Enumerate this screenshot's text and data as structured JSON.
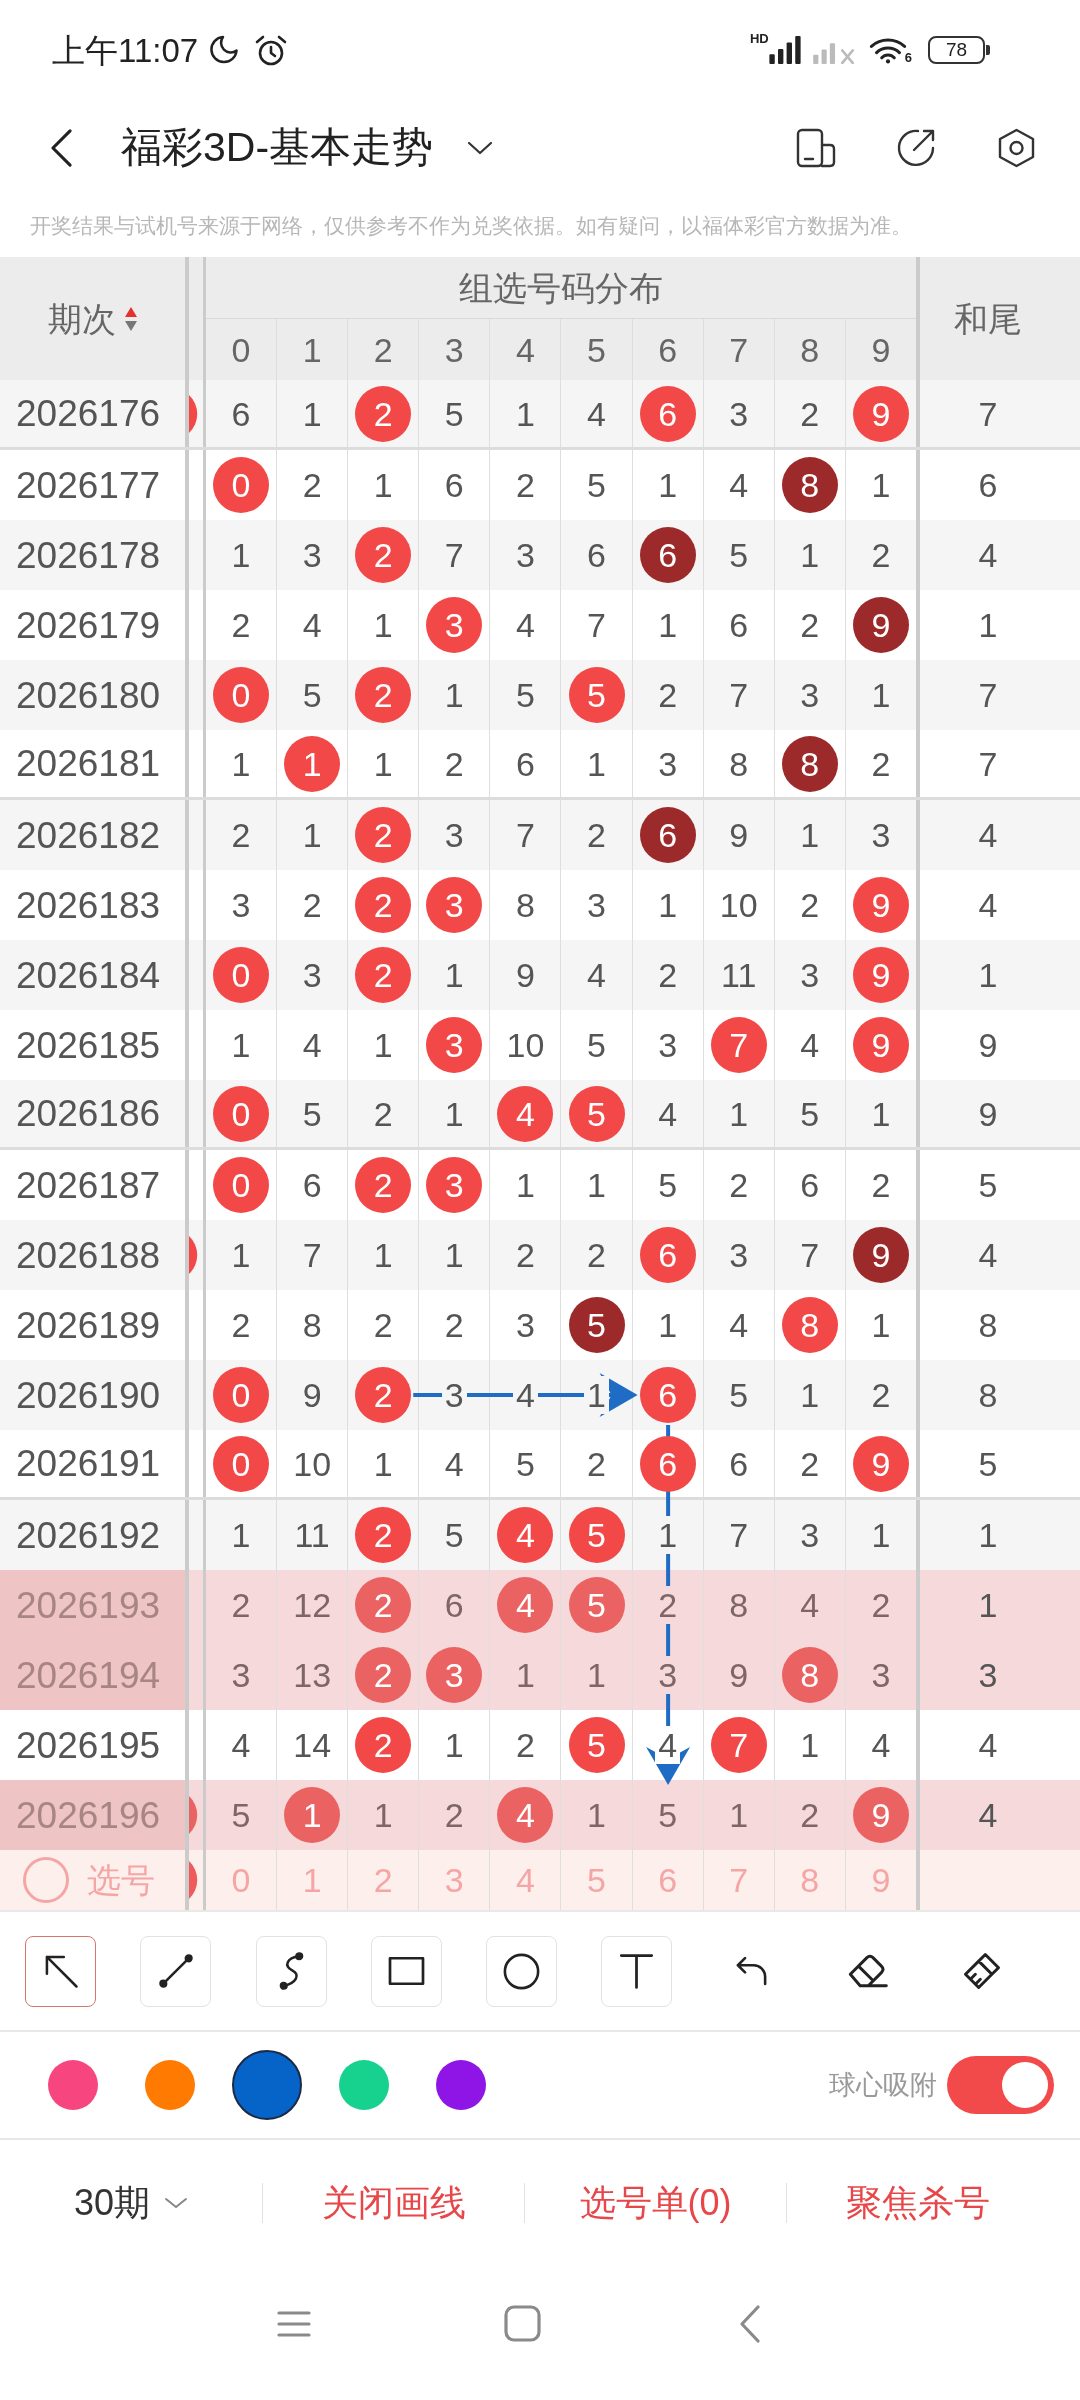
{
  "status_bar": {
    "time": "上午11:07",
    "signal_badge": "HD",
    "wifi_badge": "6",
    "battery": "78"
  },
  "header": {
    "title": "福彩3D-基本走势"
  },
  "notice": "开奖结果与试机号来源于网络，仅供参考不作为兑奖依据。如有疑问，以福体彩官方数据为准。",
  "table": {
    "period_header": "期次",
    "sort_ascending": true,
    "group_header": "组选号码分布",
    "digits": [
      "0",
      "1",
      "2",
      "3",
      "4",
      "5",
      "6",
      "7",
      "8",
      "9"
    ],
    "tail_header": "和尾",
    "rows": [
      {
        "period": "2026176",
        "highlighted": false,
        "edge_ball": true,
        "cells": [
          {
            "text": "6",
            "kind": "miss"
          },
          {
            "text": "1",
            "kind": "miss"
          },
          {
            "text": "2",
            "kind": "hit"
          },
          {
            "text": "5",
            "kind": "miss"
          },
          {
            "text": "1",
            "kind": "miss"
          },
          {
            "text": "4",
            "kind": "miss"
          },
          {
            "text": "6",
            "kind": "hit"
          },
          {
            "text": "3",
            "kind": "miss"
          },
          {
            "text": "2",
            "kind": "miss"
          },
          {
            "text": "9",
            "kind": "hit"
          }
        ],
        "tail": "7"
      },
      {
        "period": "2026177",
        "highlighted": false,
        "edge_ball": false,
        "cells": [
          {
            "text": "0",
            "kind": "hit"
          },
          {
            "text": "2",
            "kind": "miss"
          },
          {
            "text": "1",
            "kind": "miss"
          },
          {
            "text": "6",
            "kind": "miss"
          },
          {
            "text": "2",
            "kind": "miss"
          },
          {
            "text": "5",
            "kind": "miss"
          },
          {
            "text": "1",
            "kind": "miss"
          },
          {
            "text": "4",
            "kind": "miss"
          },
          {
            "text": "8",
            "kind": "repeat"
          },
          {
            "text": "1",
            "kind": "miss"
          }
        ],
        "tail": "6"
      },
      {
        "period": "2026178",
        "highlighted": false,
        "edge_ball": false,
        "cells": [
          {
            "text": "1",
            "kind": "miss"
          },
          {
            "text": "3",
            "kind": "miss"
          },
          {
            "text": "2",
            "kind": "hit"
          },
          {
            "text": "7",
            "kind": "miss"
          },
          {
            "text": "3",
            "kind": "miss"
          },
          {
            "text": "6",
            "kind": "miss"
          },
          {
            "text": "6",
            "kind": "repeat"
          },
          {
            "text": "5",
            "kind": "miss"
          },
          {
            "text": "1",
            "kind": "miss"
          },
          {
            "text": "2",
            "kind": "miss"
          }
        ],
        "tail": "4"
      },
      {
        "period": "2026179",
        "highlighted": false,
        "edge_ball": false,
        "cells": [
          {
            "text": "2",
            "kind": "miss"
          },
          {
            "text": "4",
            "kind": "miss"
          },
          {
            "text": "1",
            "kind": "miss"
          },
          {
            "text": "3",
            "kind": "hit"
          },
          {
            "text": "4",
            "kind": "miss"
          },
          {
            "text": "7",
            "kind": "miss"
          },
          {
            "text": "1",
            "kind": "miss"
          },
          {
            "text": "6",
            "kind": "miss"
          },
          {
            "text": "2",
            "kind": "miss"
          },
          {
            "text": "9",
            "kind": "repeat"
          }
        ],
        "tail": "1"
      },
      {
        "period": "2026180",
        "highlighted": false,
        "edge_ball": false,
        "cells": [
          {
            "text": "0",
            "kind": "hit"
          },
          {
            "text": "5",
            "kind": "miss"
          },
          {
            "text": "2",
            "kind": "hit"
          },
          {
            "text": "1",
            "kind": "miss"
          },
          {
            "text": "5",
            "kind": "miss"
          },
          {
            "text": "5",
            "kind": "hit"
          },
          {
            "text": "2",
            "kind": "miss"
          },
          {
            "text": "7",
            "kind": "miss"
          },
          {
            "text": "3",
            "kind": "miss"
          },
          {
            "text": "1",
            "kind": "miss"
          }
        ],
        "tail": "7"
      },
      {
        "period": "2026181",
        "highlighted": false,
        "edge_ball": false,
        "cells": [
          {
            "text": "1",
            "kind": "miss"
          },
          {
            "text": "1",
            "kind": "hit"
          },
          {
            "text": "1",
            "kind": "miss"
          },
          {
            "text": "2",
            "kind": "miss"
          },
          {
            "text": "6",
            "kind": "miss"
          },
          {
            "text": "1",
            "kind": "miss"
          },
          {
            "text": "3",
            "kind": "miss"
          },
          {
            "text": "8",
            "kind": "miss"
          },
          {
            "text": "8",
            "kind": "repeat"
          },
          {
            "text": "2",
            "kind": "miss"
          }
        ],
        "tail": "7"
      },
      {
        "period": "2026182",
        "highlighted": false,
        "edge_ball": false,
        "cells": [
          {
            "text": "2",
            "kind": "miss"
          },
          {
            "text": "1",
            "kind": "miss"
          },
          {
            "text": "2",
            "kind": "hit"
          },
          {
            "text": "3",
            "kind": "miss"
          },
          {
            "text": "7",
            "kind": "miss"
          },
          {
            "text": "2",
            "kind": "miss"
          },
          {
            "text": "6",
            "kind": "repeat"
          },
          {
            "text": "9",
            "kind": "miss"
          },
          {
            "text": "1",
            "kind": "miss"
          },
          {
            "text": "3",
            "kind": "miss"
          }
        ],
        "tail": "4"
      },
      {
        "period": "2026183",
        "highlighted": false,
        "edge_ball": false,
        "cells": [
          {
            "text": "3",
            "kind": "miss"
          },
          {
            "text": "2",
            "kind": "miss"
          },
          {
            "text": "2",
            "kind": "hit"
          },
          {
            "text": "3",
            "kind": "hit"
          },
          {
            "text": "8",
            "kind": "miss"
          },
          {
            "text": "3",
            "kind": "miss"
          },
          {
            "text": "1",
            "kind": "miss"
          },
          {
            "text": "10",
            "kind": "miss"
          },
          {
            "text": "2",
            "kind": "miss"
          },
          {
            "text": "9",
            "kind": "hit"
          }
        ],
        "tail": "4"
      },
      {
        "period": "2026184",
        "highlighted": false,
        "edge_ball": false,
        "cells": [
          {
            "text": "0",
            "kind": "hit"
          },
          {
            "text": "3",
            "kind": "miss"
          },
          {
            "text": "2",
            "kind": "hit"
          },
          {
            "text": "1",
            "kind": "miss"
          },
          {
            "text": "9",
            "kind": "miss"
          },
          {
            "text": "4",
            "kind": "miss"
          },
          {
            "text": "2",
            "kind": "miss"
          },
          {
            "text": "11",
            "kind": "miss"
          },
          {
            "text": "3",
            "kind": "miss"
          },
          {
            "text": "9",
            "kind": "hit"
          }
        ],
        "tail": "1"
      },
      {
        "period": "2026185",
        "highlighted": false,
        "edge_ball": false,
        "cells": [
          {
            "text": "1",
            "kind": "miss"
          },
          {
            "text": "4",
            "kind": "miss"
          },
          {
            "text": "1",
            "kind": "miss"
          },
          {
            "text": "3",
            "kind": "hit"
          },
          {
            "text": "10",
            "kind": "miss"
          },
          {
            "text": "5",
            "kind": "miss"
          },
          {
            "text": "3",
            "kind": "miss"
          },
          {
            "text": "7",
            "kind": "hit"
          },
          {
            "text": "4",
            "kind": "miss"
          },
          {
            "text": "9",
            "kind": "hit"
          }
        ],
        "tail": "9"
      },
      {
        "period": "2026186",
        "highlighted": false,
        "edge_ball": false,
        "cells": [
          {
            "text": "0",
            "kind": "hit"
          },
          {
            "text": "5",
            "kind": "miss"
          },
          {
            "text": "2",
            "kind": "miss"
          },
          {
            "text": "1",
            "kind": "miss"
          },
          {
            "text": "4",
            "kind": "hit"
          },
          {
            "text": "5",
            "kind": "hit"
          },
          {
            "text": "4",
            "kind": "miss"
          },
          {
            "text": "1",
            "kind": "miss"
          },
          {
            "text": "5",
            "kind": "miss"
          },
          {
            "text": "1",
            "kind": "miss"
          }
        ],
        "tail": "9"
      },
      {
        "period": "2026187",
        "highlighted": false,
        "edge_ball": false,
        "cells": [
          {
            "text": "0",
            "kind": "hit"
          },
          {
            "text": "6",
            "kind": "miss"
          },
          {
            "text": "2",
            "kind": "hit"
          },
          {
            "text": "3",
            "kind": "hit"
          },
          {
            "text": "1",
            "kind": "miss"
          },
          {
            "text": "1",
            "kind": "miss"
          },
          {
            "text": "5",
            "kind": "miss"
          },
          {
            "text": "2",
            "kind": "miss"
          },
          {
            "text": "6",
            "kind": "miss"
          },
          {
            "text": "2",
            "kind": "miss"
          }
        ],
        "tail": "5"
      },
      {
        "period": "2026188",
        "highlighted": false,
        "edge_ball": true,
        "cells": [
          {
            "text": "1",
            "kind": "miss"
          },
          {
            "text": "7",
            "kind": "miss"
          },
          {
            "text": "1",
            "kind": "miss"
          },
          {
            "text": "1",
            "kind": "miss"
          },
          {
            "text": "2",
            "kind": "miss"
          },
          {
            "text": "2",
            "kind": "miss"
          },
          {
            "text": "6",
            "kind": "hit"
          },
          {
            "text": "3",
            "kind": "miss"
          },
          {
            "text": "7",
            "kind": "miss"
          },
          {
            "text": "9",
            "kind": "repeat"
          }
        ],
        "tail": "4"
      },
      {
        "period": "2026189",
        "highlighted": false,
        "edge_ball": false,
        "cells": [
          {
            "text": "2",
            "kind": "miss"
          },
          {
            "text": "8",
            "kind": "miss"
          },
          {
            "text": "2",
            "kind": "miss"
          },
          {
            "text": "2",
            "kind": "miss"
          },
          {
            "text": "3",
            "kind": "miss"
          },
          {
            "text": "5",
            "kind": "repeat"
          },
          {
            "text": "1",
            "kind": "miss"
          },
          {
            "text": "4",
            "kind": "miss"
          },
          {
            "text": "8",
            "kind": "hit"
          },
          {
            "text": "1",
            "kind": "miss"
          }
        ],
        "tail": "8"
      },
      {
        "period": "2026190",
        "highlighted": false,
        "edge_ball": false,
        "arrow_right": true,
        "cells": [
          {
            "text": "0",
            "kind": "hit"
          },
          {
            "text": "9",
            "kind": "miss"
          },
          {
            "text": "2",
            "kind": "hit",
            "arrow_stop": true
          },
          {
            "text": "3",
            "kind": "miss"
          },
          {
            "text": "4",
            "kind": "miss"
          },
          {
            "text": "1",
            "kind": "miss"
          },
          {
            "text": "6",
            "kind": "hit",
            "arrow_stop": true,
            "arrow_down": true
          },
          {
            "text": "5",
            "kind": "miss"
          },
          {
            "text": "1",
            "kind": "miss"
          },
          {
            "text": "2",
            "kind": "miss"
          }
        ],
        "tail": "8"
      },
      {
        "period": "2026191",
        "highlighted": false,
        "edge_ball": false,
        "cells": [
          {
            "text": "0",
            "kind": "hit"
          },
          {
            "text": "10",
            "kind": "miss"
          },
          {
            "text": "1",
            "kind": "miss"
          },
          {
            "text": "4",
            "kind": "miss"
          },
          {
            "text": "5",
            "kind": "miss"
          },
          {
            "text": "2",
            "kind": "miss"
          },
          {
            "text": "6",
            "kind": "hit"
          },
          {
            "text": "6",
            "kind": "miss"
          },
          {
            "text": "2",
            "kind": "miss"
          },
          {
            "text": "9",
            "kind": "hit"
          }
        ],
        "tail": "5"
      },
      {
        "period": "2026192",
        "highlighted": false,
        "edge_ball": false,
        "cells": [
          {
            "text": "1",
            "kind": "miss"
          },
          {
            "text": "11",
            "kind": "miss"
          },
          {
            "text": "2",
            "kind": "hit"
          },
          {
            "text": "5",
            "kind": "miss"
          },
          {
            "text": "4",
            "kind": "hit"
          },
          {
            "text": "5",
            "kind": "hit"
          },
          {
            "text": "1",
            "kind": "miss"
          },
          {
            "text": "7",
            "kind": "miss"
          },
          {
            "text": "3",
            "kind": "miss"
          },
          {
            "text": "1",
            "kind": "miss"
          }
        ],
        "tail": "1"
      },
      {
        "period": "2026193",
        "highlighted": true,
        "edge_ball": false,
        "cells": [
          {
            "text": "2",
            "kind": "miss"
          },
          {
            "text": "12",
            "kind": "miss"
          },
          {
            "text": "2",
            "kind": "hit"
          },
          {
            "text": "6",
            "kind": "miss"
          },
          {
            "text": "4",
            "kind": "hit"
          },
          {
            "text": "5",
            "kind": "hit"
          },
          {
            "text": "2",
            "kind": "miss"
          },
          {
            "text": "8",
            "kind": "miss"
          },
          {
            "text": "4",
            "kind": "miss"
          },
          {
            "text": "2",
            "kind": "miss"
          }
        ],
        "tail": "1"
      },
      {
        "period": "2026194",
        "highlighted": true,
        "edge_ball": false,
        "cells": [
          {
            "text": "3",
            "kind": "miss"
          },
          {
            "text": "13",
            "kind": "miss"
          },
          {
            "text": "2",
            "kind": "hit"
          },
          {
            "text": "3",
            "kind": "hit"
          },
          {
            "text": "1",
            "kind": "miss"
          },
          {
            "text": "1",
            "kind": "miss"
          },
          {
            "text": "3",
            "kind": "miss"
          },
          {
            "text": "9",
            "kind": "miss"
          },
          {
            "text": "8",
            "kind": "hit"
          },
          {
            "text": "3",
            "kind": "miss"
          }
        ],
        "tail": "3"
      },
      {
        "period": "2026195",
        "highlighted": false,
        "edge_ball": false,
        "cells": [
          {
            "text": "4",
            "kind": "miss"
          },
          {
            "text": "14",
            "kind": "miss"
          },
          {
            "text": "2",
            "kind": "hit"
          },
          {
            "text": "1",
            "kind": "miss"
          },
          {
            "text": "2",
            "kind": "miss"
          },
          {
            "text": "5",
            "kind": "hit"
          },
          {
            "text": "4",
            "kind": "miss",
            "arrow_stop": true
          },
          {
            "text": "7",
            "kind": "hit"
          },
          {
            "text": "1",
            "kind": "miss"
          },
          {
            "text": "4",
            "kind": "miss"
          }
        ],
        "tail": "4"
      },
      {
        "period": "2026196",
        "highlighted": true,
        "edge_ball": true,
        "cells": [
          {
            "text": "5",
            "kind": "miss"
          },
          {
            "text": "1",
            "kind": "hit"
          },
          {
            "text": "1",
            "kind": "miss"
          },
          {
            "text": "2",
            "kind": "miss"
          },
          {
            "text": "4",
            "kind": "hit"
          },
          {
            "text": "1",
            "kind": "miss"
          },
          {
            "text": "5",
            "kind": "miss"
          },
          {
            "text": "1",
            "kind": "miss"
          },
          {
            "text": "2",
            "kind": "miss"
          },
          {
            "text": "9",
            "kind": "hit"
          }
        ],
        "tail": "4"
      }
    ],
    "pick_row": {
      "label": "选号",
      "edge_ball": true,
      "digits": [
        "0",
        "1",
        "2",
        "3",
        "4",
        "5",
        "6",
        "7",
        "8",
        "9"
      ]
    }
  },
  "tools": [
    {
      "kind": "pointer-arrow",
      "selected": true
    },
    {
      "kind": "line",
      "selected": false
    },
    {
      "kind": "curve",
      "selected": false
    },
    {
      "kind": "rectangle",
      "selected": false
    },
    {
      "kind": "ellipse",
      "selected": false
    },
    {
      "kind": "text",
      "selected": false
    },
    {
      "kind": "undo",
      "selected": false
    },
    {
      "kind": "eraser",
      "selected": false
    },
    {
      "kind": "clear",
      "selected": false
    }
  ],
  "colors": [
    {
      "color": "#f7467f",
      "selected": false
    },
    {
      "color": "#ff7a00",
      "selected": false
    },
    {
      "color": "#0664c8",
      "selected": true
    },
    {
      "color": "#17d18e",
      "selected": false
    },
    {
      "color": "#8f14e6",
      "selected": false
    }
  ],
  "snap": {
    "label": "球心吸附",
    "on": true
  },
  "bottom_bar": {
    "period_range": "30期",
    "actions": [
      "关闭画线",
      "选号单(0)",
      "聚焦杀号"
    ]
  }
}
